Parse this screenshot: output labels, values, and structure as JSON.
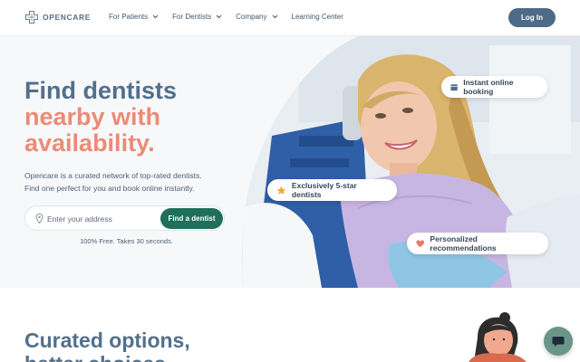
{
  "nav": {
    "logo_text": "OPENCARE",
    "links": [
      {
        "label": "For Patients",
        "has_dropdown": true
      },
      {
        "label": "For Dentists",
        "has_dropdown": true
      },
      {
        "label": "Company",
        "has_dropdown": true
      },
      {
        "label": "Learning Center",
        "has_dropdown": false
      }
    ],
    "login_label": "Log In"
  },
  "hero": {
    "headline_line1": "Find dentists",
    "headline_line2": "nearby with",
    "headline_line3": "availability.",
    "subtext_line1": "Opencare is a curated network of top-rated dentists.",
    "subtext_line2": "Find one perfect for you and book online instantly.",
    "search_placeholder": "Enter your address",
    "find_button_label": "Find a dentist",
    "free_note": "100% Free. Takes 30 seconds."
  },
  "badges": {
    "booking": "Instant online booking",
    "rated": "Exclusively 5-star dentists",
    "personal": "Personalized recommendations"
  },
  "section2": {
    "title_line1": "Curated options,",
    "title_line2": "better choices"
  },
  "colors": {
    "headline_blue": "#52708c",
    "headline_coral": "#ec8b76",
    "find_button_green": "#1f6f5c",
    "login_button": "#4e6a86",
    "chat_button": "#6a9589"
  },
  "icons": {
    "logo": "plus-cross-logo-icon",
    "dropdown": "chevron-down-icon",
    "location": "map-pin-icon",
    "booking": "calendar-icon",
    "rated": "star-icon",
    "personal": "heart-icon",
    "chat": "chat-bubble-icon"
  }
}
